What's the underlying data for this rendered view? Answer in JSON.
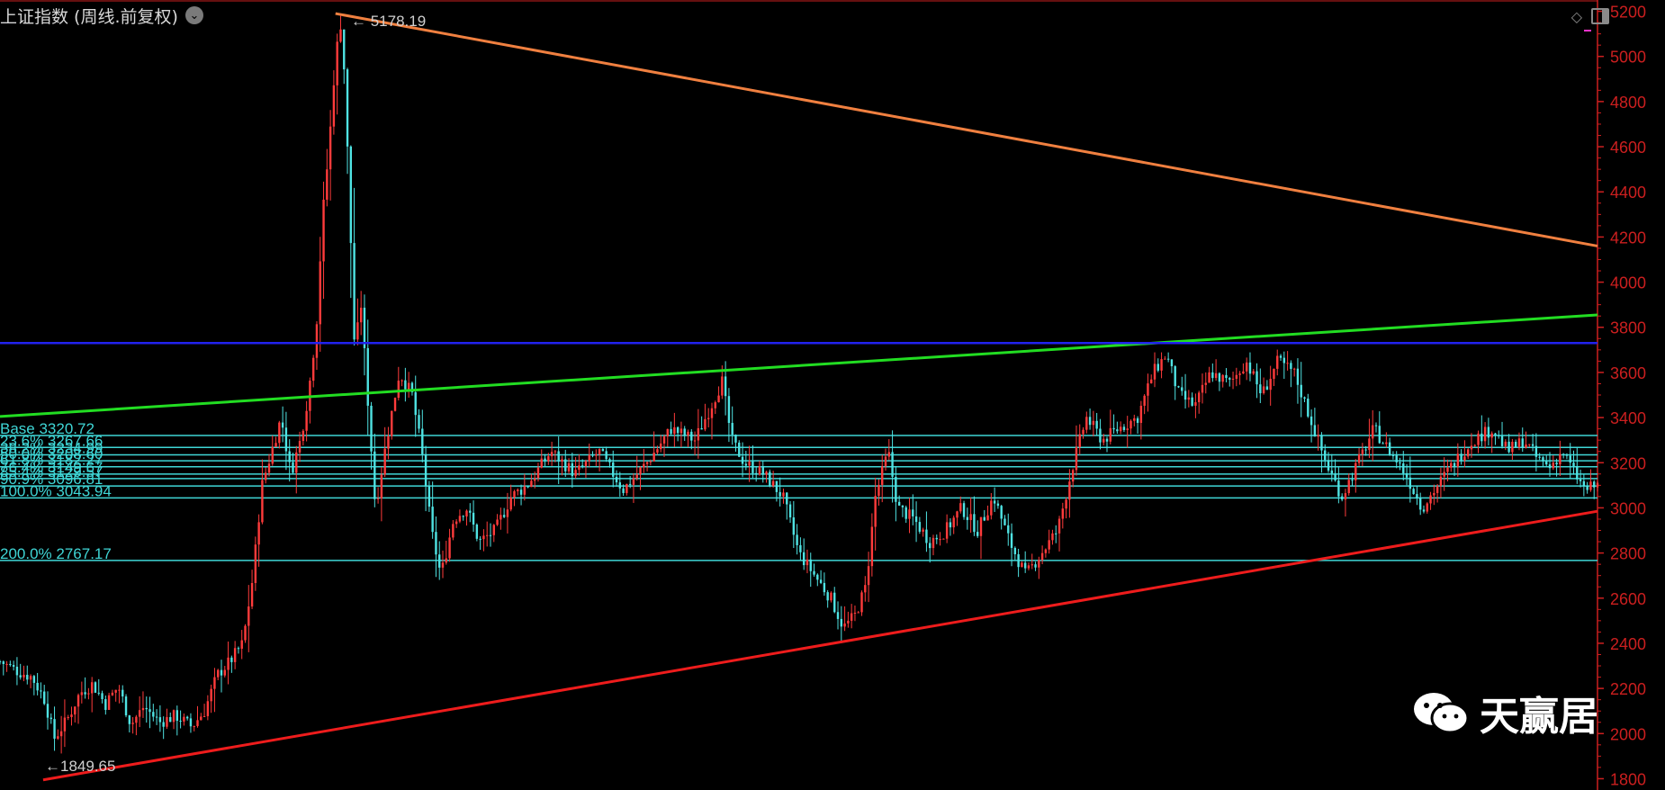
{
  "header": {
    "title": "上证指数 (周线.前复权)",
    "dropdown_icon": "chevron-down-icon"
  },
  "toolbar": {
    "icons": [
      "diamond-icon",
      "panel-toggle-icon"
    ]
  },
  "watermark": {
    "text": "天赢居",
    "icon": "wechat-icon"
  },
  "colors": {
    "up": "#ff3b3b",
    "down": "#4fe3e3",
    "fib": "#3fd6d6",
    "axis": "#cc1f1f",
    "resistance": "#f08040",
    "channel_top": "#22dd22",
    "channel_bottom": "#ee1c1c",
    "horizontal": "#2222ee"
  },
  "chart_data": {
    "type": "candlestick",
    "timeframe": "weekly",
    "ylim": [
      1750,
      5250
    ],
    "y_ticks": [
      1800,
      2000,
      2200,
      2400,
      2600,
      2800,
      3000,
      3200,
      3400,
      3600,
      3800,
      4000,
      4200,
      4400,
      4600,
      4800,
      5000,
      5200
    ],
    "annotations": [
      {
        "label": "5178.19",
        "value": 5178.19
      },
      {
        "label": "1849.65",
        "value": 1849.65
      }
    ],
    "fib_levels": [
      {
        "label": "Base 3320.72",
        "value": 3320.72
      },
      {
        "label": "23.6% 3267.66",
        "value": 3267.66
      },
      {
        "label": "38.2% 3234.99",
        "value": 3234.99
      },
      {
        "label": "50.0% 3208.60",
        "value": 3208.6
      },
      {
        "label": "61.8% 3182.27",
        "value": 3182.27
      },
      {
        "label": "76.4% 3149.67",
        "value": 3149.67
      },
      {
        "label": "85.4% 3129.57",
        "value": 3129.57
      },
      {
        "label": "90.9% 3096.81",
        "value": 3096.81
      },
      {
        "label": "100.0% 3043.94",
        "value": 3043.94
      },
      {
        "label": "200.0% 2767.17",
        "value": 2767.17
      }
    ],
    "trendlines": [
      {
        "name": "resistance",
        "start": [
          0.21,
          5190
        ],
        "end": [
          1.0,
          4160
        ]
      },
      {
        "name": "channel_top",
        "start": [
          0.0,
          3405
        ],
        "end": [
          1.0,
          3855
        ]
      },
      {
        "name": "channel_bottom",
        "start": [
          0.027,
          1795
        ],
        "end": [
          1.0,
          2985
        ]
      },
      {
        "name": "horizontal",
        "start": [
          0.0,
          3730
        ],
        "end": [
          1.0,
          3730
        ]
      }
    ],
    "close_path": [
      [
        0.0,
        2320
      ],
      [
        0.01,
        2280
      ],
      [
        0.02,
        2250
      ],
      [
        0.028,
        2150
      ],
      [
        0.034,
        1980
      ],
      [
        0.042,
        2060
      ],
      [
        0.05,
        2180
      ],
      [
        0.058,
        2220
      ],
      [
        0.066,
        2130
      ],
      [
        0.074,
        2210
      ],
      [
        0.082,
        2040
      ],
      [
        0.09,
        2120
      ],
      [
        0.1,
        2050
      ],
      [
        0.11,
        2080
      ],
      [
        0.12,
        2030
      ],
      [
        0.128,
        2100
      ],
      [
        0.136,
        2260
      ],
      [
        0.144,
        2320
      ],
      [
        0.152,
        2400
      ],
      [
        0.158,
        2680
      ],
      [
        0.164,
        3100
      ],
      [
        0.17,
        3250
      ],
      [
        0.176,
        3400
      ],
      [
        0.182,
        3150
      ],
      [
        0.188,
        3300
      ],
      [
        0.193,
        3500
      ],
      [
        0.198,
        3800
      ],
      [
        0.202,
        4300
      ],
      [
        0.206,
        4600
      ],
      [
        0.21,
        5000
      ],
      [
        0.214,
        5178
      ],
      [
        0.218,
        4500
      ],
      [
        0.222,
        3700
      ],
      [
        0.226,
        3900
      ],
      [
        0.23,
        3500
      ],
      [
        0.235,
        3000
      ],
      [
        0.242,
        3300
      ],
      [
        0.25,
        3600
      ],
      [
        0.258,
        3500
      ],
      [
        0.264,
        3250
      ],
      [
        0.27,
        2900
      ],
      [
        0.276,
        2700
      ],
      [
        0.284,
        2950
      ],
      [
        0.292,
        3000
      ],
      [
        0.3,
        2850
      ],
      [
        0.31,
        2900
      ],
      [
        0.32,
        3050
      ],
      [
        0.33,
        3100
      ],
      [
        0.345,
        3250
      ],
      [
        0.36,
        3150
      ],
      [
        0.375,
        3250
      ],
      [
        0.39,
        3080
      ],
      [
        0.405,
        3200
      ],
      [
        0.42,
        3350
      ],
      [
        0.435,
        3300
      ],
      [
        0.445,
        3450
      ],
      [
        0.452,
        3560
      ],
      [
        0.458,
        3300
      ],
      [
        0.466,
        3200
      ],
      [
        0.478,
        3150
      ],
      [
        0.49,
        3050
      ],
      [
        0.5,
        2800
      ],
      [
        0.51,
        2700
      ],
      [
        0.52,
        2600
      ],
      [
        0.528,
        2470
      ],
      [
        0.535,
        2520
      ],
      [
        0.542,
        2650
      ],
      [
        0.548,
        3050
      ],
      [
        0.556,
        3250
      ],
      [
        0.562,
        3000
      ],
      [
        0.572,
        2950
      ],
      [
        0.582,
        2850
      ],
      [
        0.592,
        2900
      ],
      [
        0.602,
        3000
      ],
      [
        0.612,
        2900
      ],
      [
        0.622,
        3050
      ],
      [
        0.632,
        2850
      ],
      [
        0.642,
        2700
      ],
      [
        0.652,
        2800
      ],
      [
        0.662,
        2900
      ],
      [
        0.672,
        3200
      ],
      [
        0.68,
        3400
      ],
      [
        0.69,
        3300
      ],
      [
        0.7,
        3350
      ],
      [
        0.712,
        3400
      ],
      [
        0.722,
        3600
      ],
      [
        0.73,
        3680
      ],
      [
        0.738,
        3500
      ],
      [
        0.748,
        3450
      ],
      [
        0.758,
        3600
      ],
      [
        0.77,
        3550
      ],
      [
        0.78,
        3650
      ],
      [
        0.79,
        3500
      ],
      [
        0.8,
        3650
      ],
      [
        0.81,
        3600
      ],
      [
        0.82,
        3400
      ],
      [
        0.83,
        3200
      ],
      [
        0.84,
        3050
      ],
      [
        0.85,
        3200
      ],
      [
        0.86,
        3350
      ],
      [
        0.87,
        3250
      ],
      [
        0.88,
        3150
      ],
      [
        0.89,
        3000
      ],
      [
        0.9,
        3100
      ],
      [
        0.91,
        3200
      ],
      [
        0.922,
        3300
      ],
      [
        0.934,
        3350
      ],
      [
        0.944,
        3250
      ],
      [
        0.954,
        3300
      ],
      [
        0.962,
        3220
      ],
      [
        0.97,
        3180
      ],
      [
        0.978,
        3250
      ],
      [
        0.986,
        3150
      ],
      [
        0.992,
        3080
      ],
      [
        1.0,
        3100
      ]
    ]
  }
}
